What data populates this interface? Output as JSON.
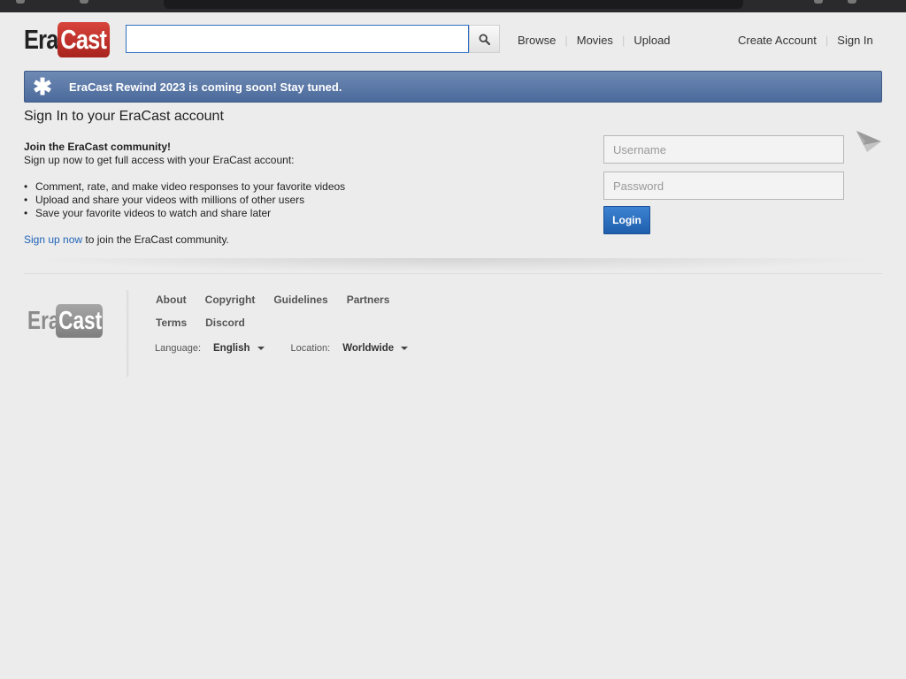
{
  "header": {
    "logo_left": "Era",
    "logo_right": "Cast",
    "search": {
      "value": "",
      "placeholder": ""
    },
    "nav": [
      "Browse",
      "Movies",
      "Upload"
    ],
    "account": [
      "Create Account",
      "Sign In"
    ]
  },
  "banner": {
    "icon": "asterisk-icon",
    "message": "EraCast Rewind 2023 is coming soon! Stay tuned."
  },
  "page_title": "Sign In to your EraCast account",
  "join": {
    "title": "Join the EraCast community!",
    "subtitle": "Sign up now to get full access with your EraCast account:",
    "benefits": [
      "Comment, rate, and make video responses to your favorite videos",
      "Upload and share your videos with millions of other users",
      "Save your favorite videos to watch and share later"
    ],
    "signup_link": "Sign up now",
    "signup_suffix": " to join the EraCast community."
  },
  "login": {
    "username_placeholder": "Username",
    "password_placeholder": "Password",
    "button": "Login"
  },
  "footer": {
    "logo_left": "Era",
    "logo_right": "Cast",
    "links_row1": [
      "About",
      "Copyright",
      "Guidelines",
      "Partners"
    ],
    "links_row2": [
      "Terms",
      "Discord"
    ],
    "language_label": "Language:",
    "language_value": "English",
    "location_label": "Location:",
    "location_value": "Worldwide"
  },
  "colors": {
    "brand_red": "#c0312a",
    "banner_blue": "#5a78a8",
    "link_blue": "#1f63b8",
    "login_blue": "#2a6fc0"
  }
}
